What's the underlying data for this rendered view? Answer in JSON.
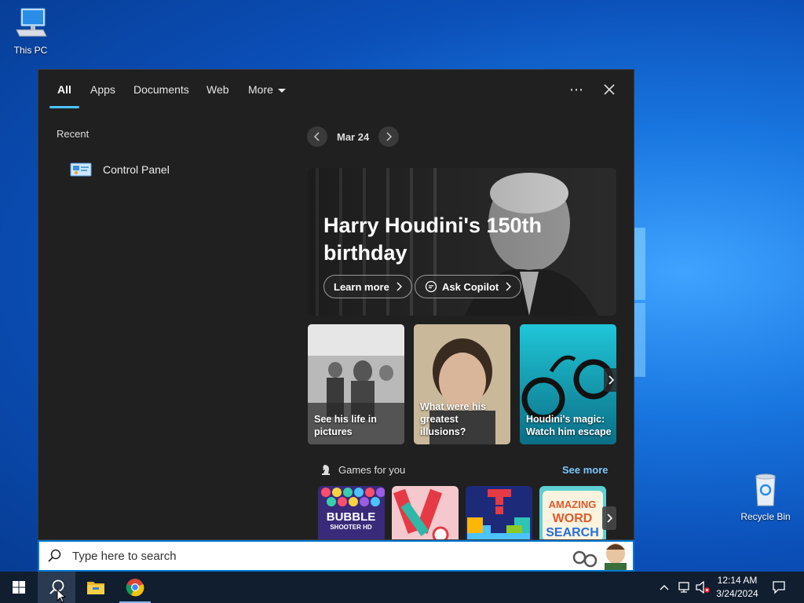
{
  "desktop": {
    "icons": [
      {
        "label": "This PC"
      },
      {
        "label": "Recycle Bin"
      }
    ]
  },
  "search_panel": {
    "tabs": [
      {
        "label": "All"
      },
      {
        "label": "Apps"
      },
      {
        "label": "Documents"
      },
      {
        "label": "Web"
      },
      {
        "label": "More"
      }
    ],
    "recent": {
      "heading": "Recent",
      "items": [
        {
          "label": "Control Panel"
        }
      ]
    },
    "highlight": {
      "date": "Mar 24",
      "hero_title": "Harry Houdini's 150th birthday",
      "learn_more": "Learn more",
      "ask_copilot": "Ask Copilot",
      "cards": [
        {
          "caption": "See his life in pictures"
        },
        {
          "caption": "What were his greatest illusions?"
        },
        {
          "caption": "Houdini's magic: Watch him escape"
        }
      ]
    },
    "games": {
      "heading": "Games for you",
      "see_more": "See more",
      "tiles": [
        {
          "line1": "BUBBLE",
          "line2": "SHOOTER HD"
        },
        {
          "line1": ""
        },
        {
          "line1": ""
        },
        {
          "line1": "AMAZING",
          "line2": "WORD",
          "line3": "SEARCH"
        }
      ]
    }
  },
  "searchbox": {
    "placeholder": "Type here to search"
  },
  "taskbar": {
    "clock_time": "12:14 AM",
    "clock_date": "3/24/2024"
  },
  "colors": {
    "accent": "#0078d4",
    "tab_indicator": "#4cc2ff",
    "link": "#7cc6ff"
  }
}
